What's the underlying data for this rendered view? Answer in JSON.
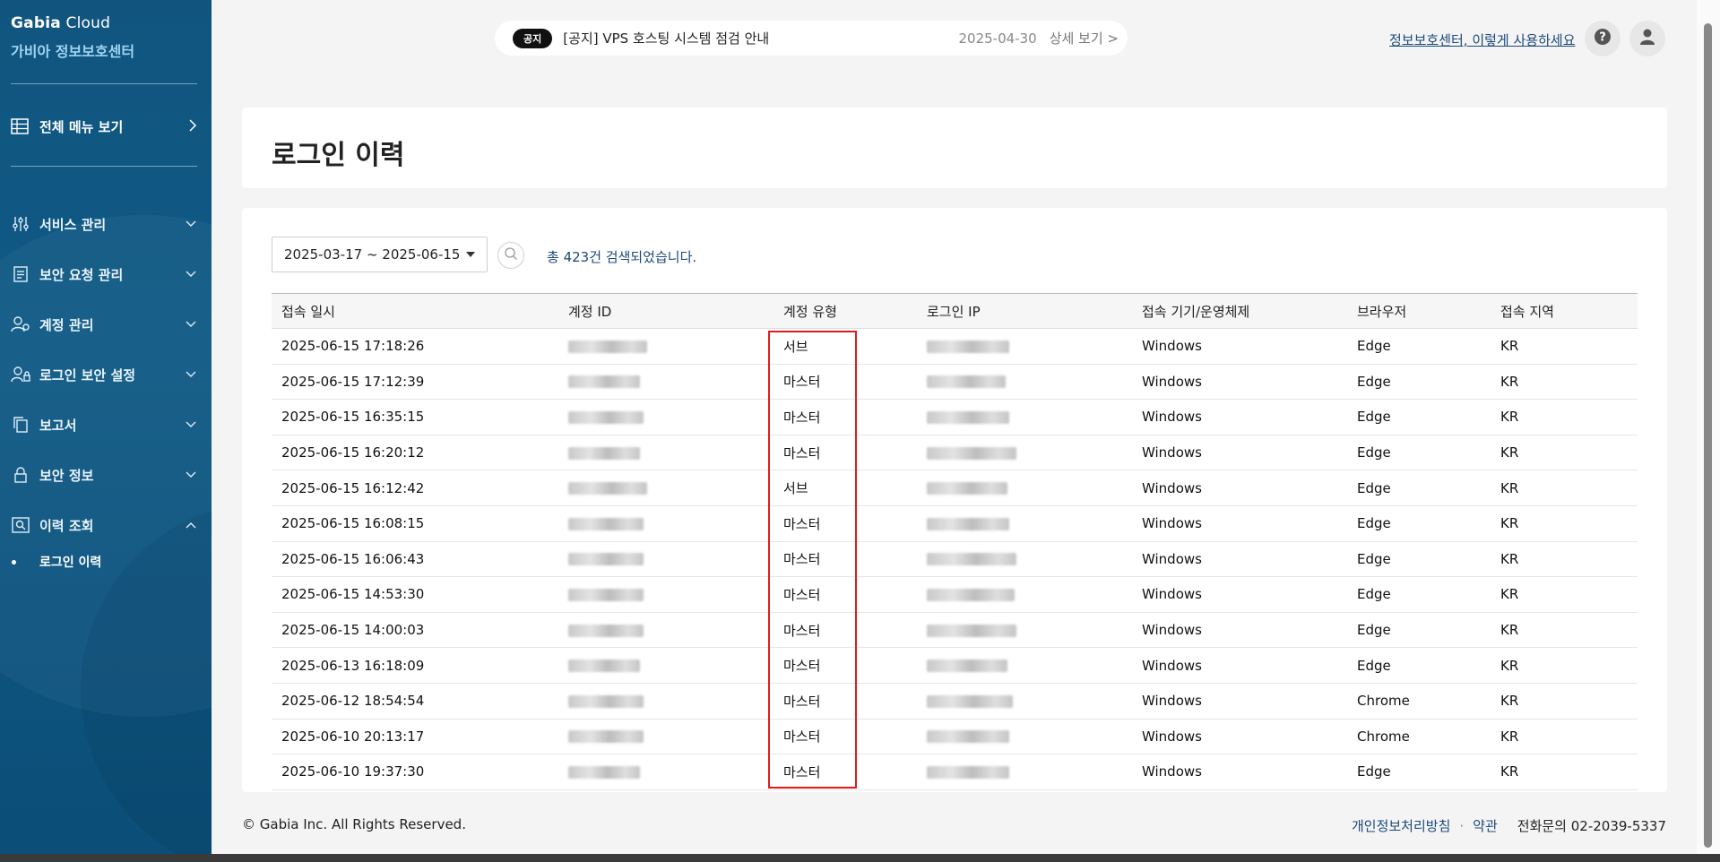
{
  "brand": {
    "line1_bold": "Gabia",
    "line1_rest": " Cloud",
    "line2": "가비아 정보보호센터"
  },
  "sidebar": {
    "all_menu": "전체 메뉴 보기",
    "items": [
      {
        "label": "서비스 관리",
        "icon": "sliders-icon"
      },
      {
        "label": "보안 요청 관리",
        "icon": "document-icon"
      },
      {
        "label": "계정 관리",
        "icon": "user-settings-icon"
      },
      {
        "label": "로그인 보안 설정",
        "icon": "user-lock-icon"
      },
      {
        "label": "보고서",
        "icon": "copy-icon"
      },
      {
        "label": "보안 정보",
        "icon": "lock-icon"
      },
      {
        "label": "이력 조회",
        "icon": "search-history-icon"
      }
    ],
    "sub_items": [
      "로그인 이력"
    ]
  },
  "notice": {
    "badge": "공지",
    "title": "[공지] VPS 호스팅 시스템 점검 안내",
    "date": "2025-04-30",
    "more": "상세 보기 >"
  },
  "header": {
    "help_link": "정보보호센터, 이렇게 사용하세요"
  },
  "page": {
    "title": "로그인 이력"
  },
  "filter": {
    "date_range": "2025-03-17 ~ 2025-06-15",
    "result_text": "총 423건 검색되었습니다."
  },
  "table": {
    "columns": [
      "접속 일시",
      "계정 ID",
      "계정 유형",
      "로그인 IP",
      "접속 기기/운영체제",
      "브라우저",
      "접속 지역"
    ],
    "rows": [
      {
        "time": "2025-06-15 17:18:26",
        "type": "서브",
        "os": "Windows",
        "browser": "Edge",
        "region": "KR"
      },
      {
        "time": "2025-06-15 17:12:39",
        "type": "마스터",
        "os": "Windows",
        "browser": "Edge",
        "region": "KR"
      },
      {
        "time": "2025-06-15 16:35:15",
        "type": "마스터",
        "os": "Windows",
        "browser": "Edge",
        "region": "KR"
      },
      {
        "time": "2025-06-15 16:20:12",
        "type": "마스터",
        "os": "Windows",
        "browser": "Edge",
        "region": "KR"
      },
      {
        "time": "2025-06-15 16:12:42",
        "type": "서브",
        "os": "Windows",
        "browser": "Edge",
        "region": "KR"
      },
      {
        "time": "2025-06-15 16:08:15",
        "type": "마스터",
        "os": "Windows",
        "browser": "Edge",
        "region": "KR"
      },
      {
        "time": "2025-06-15 16:06:43",
        "type": "마스터",
        "os": "Windows",
        "browser": "Edge",
        "region": "KR"
      },
      {
        "time": "2025-06-15 14:53:30",
        "type": "마스터",
        "os": "Windows",
        "browser": "Edge",
        "region": "KR"
      },
      {
        "time": "2025-06-15 14:00:03",
        "type": "마스터",
        "os": "Windows",
        "browser": "Edge",
        "region": "KR"
      },
      {
        "time": "2025-06-13 16:18:09",
        "type": "마스터",
        "os": "Windows",
        "browser": "Edge",
        "region": "KR"
      },
      {
        "time": "2025-06-12 18:54:54",
        "type": "마스터",
        "os": "Windows",
        "browser": "Chrome",
        "region": "KR"
      },
      {
        "time": "2025-06-10 20:13:17",
        "type": "마스터",
        "os": "Windows",
        "browser": "Chrome",
        "region": "KR"
      },
      {
        "time": "2025-06-10 19:37:30",
        "type": "마스터",
        "os": "Windows",
        "browser": "Edge",
        "region": "KR"
      }
    ]
  },
  "footer": {
    "copyright": "© Gabia Inc. All Rights Reserved.",
    "privacy": "개인정보처리방침",
    "terms": "약관",
    "phone": "전화문의 02-2039-5337"
  },
  "colors": {
    "sidebar": "#11557f",
    "accent_text": "#1c4a7a",
    "highlight": "#e01b1b"
  }
}
